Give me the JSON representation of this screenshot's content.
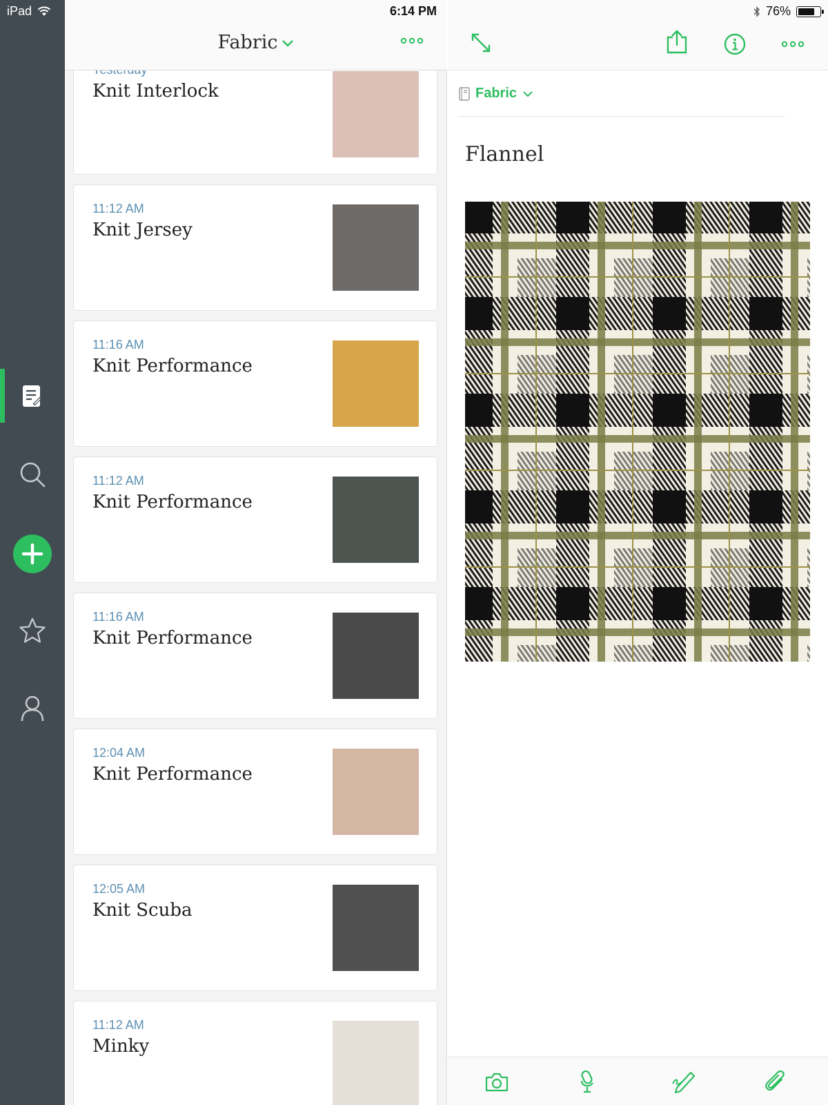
{
  "status_bar": {
    "device": "iPad",
    "time": "6:14 PM",
    "battery": "76%",
    "battery_level": 0.76
  },
  "sidebar": {
    "items": [
      {
        "name": "notes",
        "icon": "notes-icon",
        "active": true
      },
      {
        "name": "search",
        "icon": "search-icon"
      },
      {
        "name": "new-note",
        "icon": "plus-icon"
      },
      {
        "name": "shortcuts",
        "icon": "star-icon"
      },
      {
        "name": "account",
        "icon": "person-icon"
      }
    ]
  },
  "list": {
    "notebook_title": "Fabric",
    "partial_date": "Yesterday",
    "notes": [
      {
        "date": "",
        "title": "Knit Interlock",
        "color": "#dcc0b7"
      },
      {
        "date": "11:12 AM",
        "title": "Knit Jersey",
        "color": "#6e6a68"
      },
      {
        "date": "11:16 AM",
        "title": "Knit Performance",
        "color": "#d8a64a"
      },
      {
        "date": "11:12 AM",
        "title": "Knit Performance",
        "color": "#4d5550"
      },
      {
        "date": "11:16 AM",
        "title": "Knit Performance",
        "color": "#4a4a4a"
      },
      {
        "date": "12:04 AM",
        "title": "Knit Performance",
        "color": "#d4b6a3"
      },
      {
        "date": "12:05 AM",
        "title": "Knit Scuba",
        "color": "#505050"
      },
      {
        "date": "11:12 AM",
        "title": "Minky",
        "color": "#e4e0d8"
      }
    ]
  },
  "detail": {
    "notebook": "Fabric",
    "note_title": "Flannel",
    "accent": "#2dbe60"
  }
}
